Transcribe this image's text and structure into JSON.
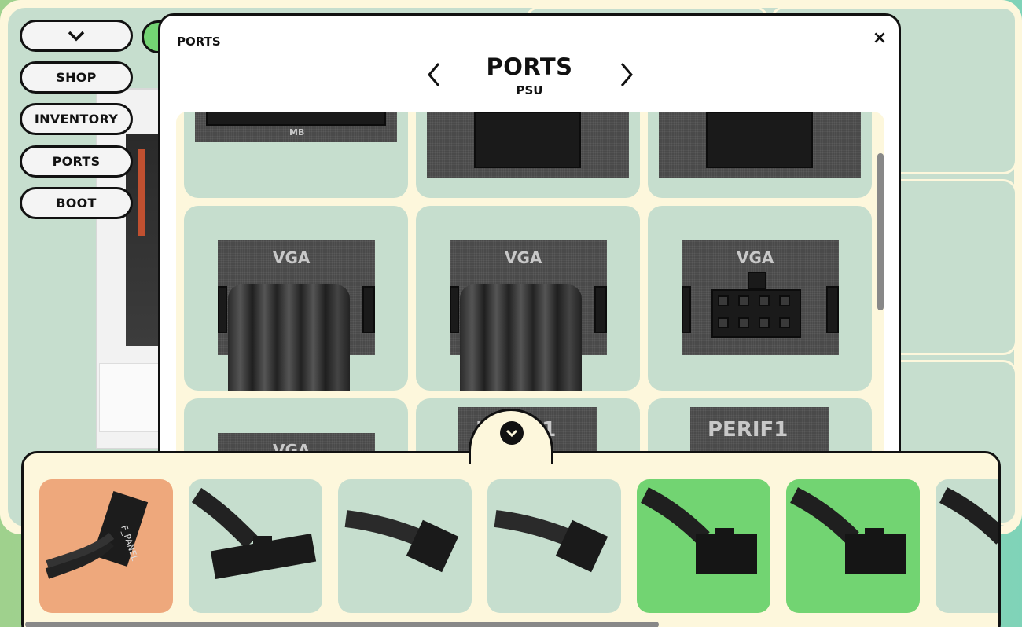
{
  "menu": {
    "toggle_icon": "chevron-down-icon",
    "items": [
      {
        "label": "SHOP"
      },
      {
        "label": "INVENTORY"
      },
      {
        "label": "PORTS"
      },
      {
        "label": "BOOT"
      }
    ]
  },
  "modal": {
    "small_title": "PORTS",
    "close_label": "×",
    "heading": "PORTS",
    "subheading": "PSU",
    "prev_icon": "chevron-left-icon",
    "next_icon": "chevron-right-icon",
    "ports": [
      {
        "label": "MB"
      },
      {
        "label": ""
      },
      {
        "label": ""
      },
      {
        "label": "VGA",
        "connected": true
      },
      {
        "label": "VGA",
        "connected": true
      },
      {
        "label": "VGA",
        "connected": false
      },
      {
        "label": "VGA"
      },
      {
        "label": "PERIF1"
      },
      {
        "label": "PERIF1"
      }
    ]
  },
  "collapse_icon": "chevron-down-icon",
  "tray": {
    "cables": [
      {
        "name": "F_PANEL",
        "label": "F_PANEL",
        "bg": "#eea87c"
      },
      {
        "name": "24-pin ATX",
        "bg": "#c6dece"
      },
      {
        "name": "8-pin",
        "bg": "#c6dece"
      },
      {
        "name": "8-pin",
        "bg": "#c6dece"
      },
      {
        "name": "8-pin PCIe",
        "bg": "#72d472"
      },
      {
        "name": "8-pin PCIe",
        "bg": "#72d472"
      },
      {
        "name": "8-pin",
        "bg": "#c6dece"
      }
    ]
  },
  "colors": {
    "cream": "#fdf7dc",
    "sage": "#c6dece",
    "green": "#72d472",
    "orange": "#eea87c"
  }
}
